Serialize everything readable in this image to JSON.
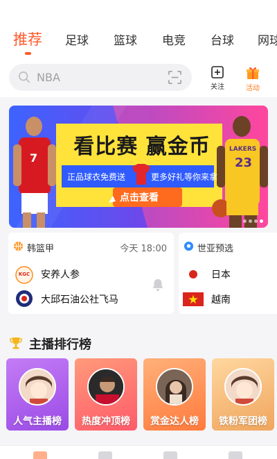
{
  "tabs": [
    {
      "label": "推荐",
      "active": true
    },
    {
      "label": "足球"
    },
    {
      "label": "篮球"
    },
    {
      "label": "电竞"
    },
    {
      "label": "台球"
    },
    {
      "label": "网球"
    }
  ],
  "search": {
    "placeholder": "NBA"
  },
  "actions": {
    "follow_label": "关注",
    "activity_label": "活动"
  },
  "banner": {
    "headline": "看比赛 赢金币",
    "sub_left": "正品球衣免费送",
    "sub_right": "更多好礼等你来拿",
    "cta": "点击查看",
    "player_left_number": "7",
    "player_right_team": "LAKERS",
    "player_right_number": "23"
  },
  "matches": [
    {
      "league": "韩篮甲",
      "time": "今天 18:00",
      "home": "安养人参",
      "home_logo_text": "KGC",
      "away": "大邱石油公社飞马"
    },
    {
      "league": "世亚预选",
      "home": "日本",
      "away": "越南"
    }
  ],
  "ranking": {
    "title": "主播排行榜",
    "cards": [
      {
        "label": "人气主播榜"
      },
      {
        "label": "热度冲顶榜"
      },
      {
        "label": "赏金达人榜"
      },
      {
        "label": "铁粉军团榜"
      }
    ]
  },
  "colors": {
    "accent": "#ff5a2c",
    "activity": "#ff7a1a"
  }
}
